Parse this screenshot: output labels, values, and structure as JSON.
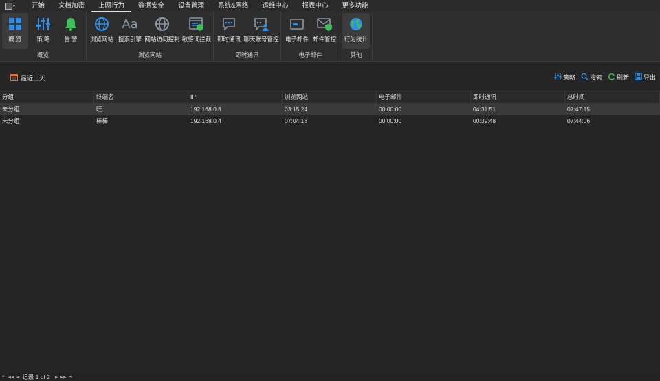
{
  "menubar": {
    "items": [
      "开始",
      "文档加密",
      "上网行为",
      "数据安全",
      "设备管理",
      "系统&网络",
      "运维中心",
      "报表中心",
      "更多功能"
    ],
    "active_index": 2
  },
  "ribbon": {
    "groups": [
      {
        "label": "概览",
        "buttons": [
          {
            "label": "概 览",
            "icon": "grid-icon",
            "selected": true
          },
          {
            "label": "策 略",
            "icon": "sliders-icon"
          },
          {
            "label": "告 警",
            "icon": "bell-icon"
          }
        ]
      },
      {
        "label": "浏览网站",
        "buttons": [
          {
            "label": "浏览网站",
            "icon": "globe-icon"
          },
          {
            "label": "搜索引擎",
            "icon": "font-aa-icon"
          },
          {
            "label": "网站访问控制",
            "icon": "globe-control-icon"
          },
          {
            "label": "敏感词拦截",
            "icon": "browser-shield-icon"
          }
        ]
      },
      {
        "label": "即时通讯",
        "buttons": [
          {
            "label": "即时通讯",
            "icon": "chat-icon"
          },
          {
            "label": "聊天账号管控",
            "icon": "chat-user-icon"
          }
        ]
      },
      {
        "label": "电子邮件",
        "buttons": [
          {
            "label": "电子邮件",
            "icon": "mail-card-icon"
          },
          {
            "label": "邮件管控",
            "icon": "mail-shield-icon"
          }
        ]
      },
      {
        "label": "其他",
        "buttons": [
          {
            "label": "行为统计",
            "icon": "globe-stats-icon",
            "selected": true
          }
        ]
      }
    ]
  },
  "toolbar": {
    "date_range": "最近三天",
    "strategy": "策略",
    "search": "搜索",
    "refresh": "刷新",
    "export": "导出"
  },
  "grid": {
    "columns": [
      "分组",
      "终端名",
      "IP",
      "浏览网站",
      "电子邮件",
      "即时通讯",
      "总时间"
    ],
    "rows": [
      [
        "未分组",
        "旺",
        "192.168.0.8",
        "03:15:24",
        "00:00:00",
        "04:31:51",
        "07:47:15"
      ],
      [
        "未分组",
        "棒棒",
        "192.168.0.4",
        "07:04:18",
        "00:00:00",
        "00:39:48",
        "07:44:06"
      ]
    ]
  },
  "pager": {
    "record_text": "记录 1 of 2"
  },
  "colors": {
    "accent_blue": "#2f8fe6",
    "accent_green": "#3fbf5a",
    "background": "#252526"
  }
}
